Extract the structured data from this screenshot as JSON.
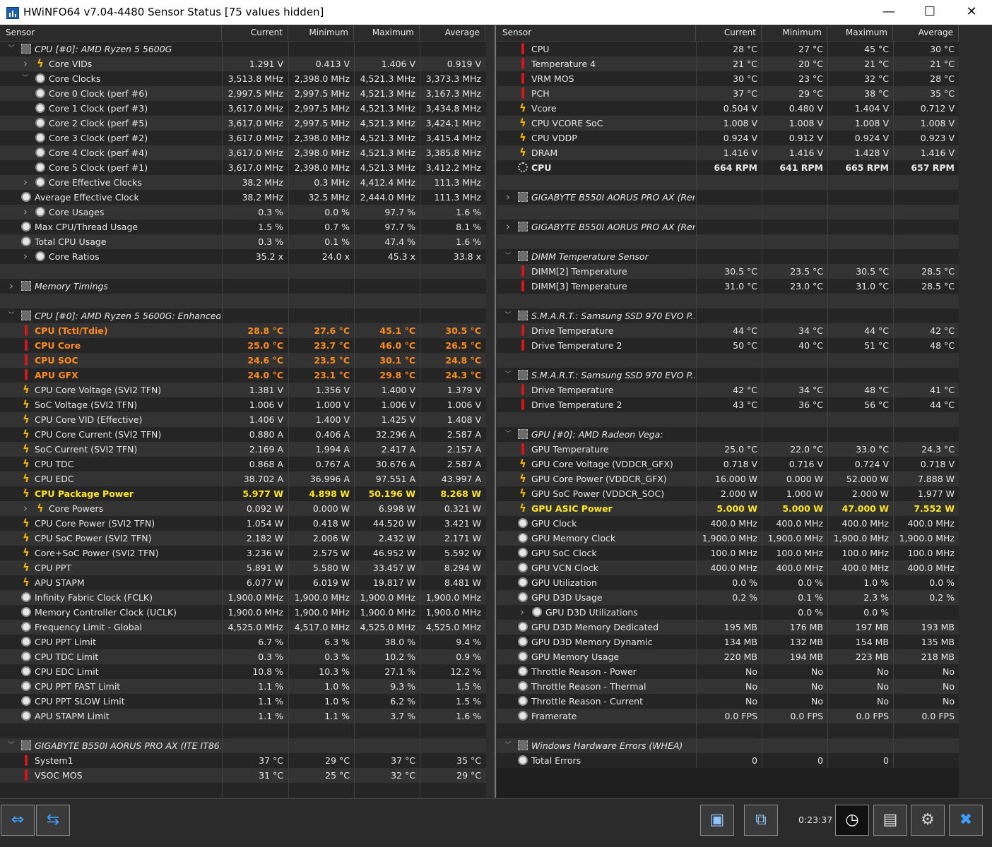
{
  "window": {
    "title": "HWiNFO64 v7.04-4480 Sensor Status [75 values hidden]",
    "minimize": "—",
    "maximize": "☐",
    "close": "✕"
  },
  "columns": {
    "sensor": "Sensor",
    "current": "Current",
    "minimum": "Minimum",
    "maximum": "Maximum",
    "average": "Average"
  },
  "left_rows": [
    {
      "type": "group",
      "expand": "v",
      "icon": "chip",
      "name": "CPU [#0]: AMD Ryzen 5 5600G",
      "vals": [
        "",
        "",
        "",
        ""
      ]
    },
    {
      "expand": ">",
      "icon": "bolt",
      "indent": 1,
      "name": "Core VIDs",
      "vals": [
        "1.291 V",
        "0.413 V",
        "1.406 V",
        "0.919 V"
      ]
    },
    {
      "expand": "v",
      "icon": "clock",
      "indent": 1,
      "name": "Core Clocks",
      "vals": [
        "3,513.8 MHz",
        "2,398.0 MHz",
        "4,521.3 MHz",
        "3,373.3 MHz"
      ]
    },
    {
      "icon": "clock",
      "indent": 1,
      "name": "Core 0 Clock (perf #6)",
      "vals": [
        "2,997.5 MHz",
        "2,997.5 MHz",
        "4,521.3 MHz",
        "3,167.3 MHz"
      ]
    },
    {
      "icon": "clock",
      "indent": 1,
      "name": "Core 1 Clock (perf #3)",
      "vals": [
        "3,617.0 MHz",
        "2,997.5 MHz",
        "4,521.3 MHz",
        "3,434.8 MHz"
      ]
    },
    {
      "icon": "clock",
      "indent": 1,
      "name": "Core 2 Clock (perf #5)",
      "vals": [
        "3,617.0 MHz",
        "2,997.5 MHz",
        "4,521.3 MHz",
        "3,424.1 MHz"
      ]
    },
    {
      "icon": "clock",
      "indent": 1,
      "name": "Core 3 Clock (perf #2)",
      "vals": [
        "3,617.0 MHz",
        "2,398.0 MHz",
        "4,521.3 MHz",
        "3,415.4 MHz"
      ]
    },
    {
      "icon": "clock",
      "indent": 1,
      "name": "Core 4 Clock (perf #4)",
      "vals": [
        "3,617.0 MHz",
        "2,398.0 MHz",
        "4,521.3 MHz",
        "3,385.8 MHz"
      ]
    },
    {
      "icon": "clock",
      "indent": 1,
      "name": "Core 5 Clock (perf #1)",
      "vals": [
        "3,617.0 MHz",
        "2,398.0 MHz",
        "4,521.3 MHz",
        "3,412.2 MHz"
      ]
    },
    {
      "expand": ">",
      "icon": "clock",
      "indent": 1,
      "name": "Core Effective Clocks",
      "vals": [
        "38.2 MHz",
        "0.3 MHz",
        "4,412.4 MHz",
        "111.3 MHz"
      ]
    },
    {
      "icon": "clock",
      "indent": 0,
      "name": "Average Effective Clock",
      "vals": [
        "38.2 MHz",
        "32.5 MHz",
        "2,444.0 MHz",
        "111.3 MHz"
      ]
    },
    {
      "expand": ">",
      "icon": "clock",
      "indent": 1,
      "name": "Core Usages",
      "vals": [
        "0.3 %",
        "0.0 %",
        "97.7 %",
        "1.6 %"
      ]
    },
    {
      "icon": "clock",
      "indent": 0,
      "name": "Max CPU/Thread Usage",
      "vals": [
        "1.5 %",
        "0.7 %",
        "97.7 %",
        "8.1 %"
      ]
    },
    {
      "icon": "clock",
      "indent": 0,
      "name": "Total CPU Usage",
      "vals": [
        "0.3 %",
        "0.1 %",
        "47.4 %",
        "1.6 %"
      ]
    },
    {
      "expand": ">",
      "icon": "clock",
      "indent": 1,
      "name": "Core Ratios",
      "vals": [
        "35.2 x",
        "24.0 x",
        "45.3 x",
        "33.8 x"
      ]
    },
    {
      "type": "blank",
      "name": "",
      "vals": [
        "",
        "",
        "",
        ""
      ]
    },
    {
      "type": "group",
      "expand": ">",
      "icon": "chip",
      "name": "Memory Timings",
      "vals": [
        "",
        "",
        "",
        ""
      ]
    },
    {
      "type": "blank",
      "name": "",
      "vals": [
        "",
        "",
        "",
        ""
      ]
    },
    {
      "type": "group",
      "expand": "v",
      "icon": "chip",
      "name": "CPU [#0]: AMD Ryzen 5 5600G: Enhanced",
      "vals": [
        "",
        "",
        "",
        ""
      ]
    },
    {
      "style": "orange",
      "icon": "thermo",
      "indent": 0,
      "name": "CPU (Tctl/Tdie)",
      "vals": [
        "28.8 °C",
        "27.6 °C",
        "45.1 °C",
        "30.5 °C"
      ]
    },
    {
      "style": "orange",
      "icon": "thermo",
      "indent": 0,
      "name": "CPU Core",
      "vals": [
        "25.0 °C",
        "23.7 °C",
        "46.0 °C",
        "26.5 °C"
      ]
    },
    {
      "style": "orange",
      "icon": "thermo",
      "indent": 0,
      "name": "CPU SOC",
      "vals": [
        "24.6 °C",
        "23.5 °C",
        "30.1 °C",
        "24.8 °C"
      ]
    },
    {
      "style": "orange",
      "icon": "thermo",
      "indent": 0,
      "name": "APU GFX",
      "vals": [
        "24.0 °C",
        "23.1 °C",
        "29.8 °C",
        "24.3 °C"
      ]
    },
    {
      "icon": "bolt",
      "indent": 0,
      "name": "CPU Core Voltage (SVI2 TFN)",
      "vals": [
        "1.381 V",
        "1.356 V",
        "1.400 V",
        "1.379 V"
      ]
    },
    {
      "icon": "bolt",
      "indent": 0,
      "name": "SoC Voltage (SVI2 TFN)",
      "vals": [
        "1.006 V",
        "1.000 V",
        "1.006 V",
        "1.006 V"
      ]
    },
    {
      "icon": "bolt",
      "indent": 0,
      "name": "CPU Core VID (Effective)",
      "vals": [
        "1.406 V",
        "1.400 V",
        "1.425 V",
        "1.408 V"
      ]
    },
    {
      "icon": "bolt",
      "indent": 0,
      "name": "CPU Core Current (SVI2 TFN)",
      "vals": [
        "0.880 A",
        "0.406 A",
        "32.296 A",
        "2.587 A"
      ]
    },
    {
      "icon": "bolt",
      "indent": 0,
      "name": "SoC Current (SVI2 TFN)",
      "vals": [
        "2.169 A",
        "1.994 A",
        "2.417 A",
        "2.157 A"
      ]
    },
    {
      "icon": "bolt",
      "indent": 0,
      "name": "CPU TDC",
      "vals": [
        "0.868 A",
        "0.767 A",
        "30.676 A",
        "2.587 A"
      ]
    },
    {
      "icon": "bolt",
      "indent": 0,
      "name": "CPU EDC",
      "vals": [
        "38.702 A",
        "36.996 A",
        "97.551 A",
        "43.997 A"
      ]
    },
    {
      "style": "yellow",
      "icon": "bolt",
      "indent": 0,
      "name": "CPU Package Power",
      "vals": [
        "5.977 W",
        "4.898 W",
        "50.196 W",
        "8.268 W"
      ]
    },
    {
      "expand": ">",
      "icon": "bolt",
      "indent": 1,
      "name": "Core Powers",
      "vals": [
        "0.092 W",
        "0.000 W",
        "6.998 W",
        "0.321 W"
      ]
    },
    {
      "icon": "bolt",
      "indent": 0,
      "name": "CPU Core Power (SVI2 TFN)",
      "vals": [
        "1.054 W",
        "0.418 W",
        "44.520 W",
        "3.421 W"
      ]
    },
    {
      "icon": "bolt",
      "indent": 0,
      "name": "CPU SoC Power (SVI2 TFN)",
      "vals": [
        "2.182 W",
        "2.006 W",
        "2.432 W",
        "2.171 W"
      ]
    },
    {
      "icon": "bolt",
      "indent": 0,
      "name": "Core+SoC Power (SVI2 TFN)",
      "vals": [
        "3.236 W",
        "2.575 W",
        "46.952 W",
        "5.592 W"
      ]
    },
    {
      "icon": "bolt",
      "indent": 0,
      "name": "CPU PPT",
      "vals": [
        "5.891 W",
        "5.580 W",
        "33.457 W",
        "8.294 W"
      ]
    },
    {
      "icon": "bolt",
      "indent": 0,
      "name": "APU STAPM",
      "vals": [
        "6.077 W",
        "6.019 W",
        "19.817 W",
        "8.481 W"
      ]
    },
    {
      "icon": "clock",
      "indent": 0,
      "name": "Infinity Fabric Clock (FCLK)",
      "vals": [
        "1,900.0 MHz",
        "1,900.0 MHz",
        "1,900.0 MHz",
        "1,900.0 MHz"
      ]
    },
    {
      "icon": "clock",
      "indent": 0,
      "name": "Memory Controller Clock (UCLK)",
      "vals": [
        "1,900.0 MHz",
        "1,900.0 MHz",
        "1,900.0 MHz",
        "1,900.0 MHz"
      ]
    },
    {
      "icon": "clock",
      "indent": 0,
      "name": "Frequency Limit - Global",
      "vals": [
        "4,525.0 MHz",
        "4,517.0 MHz",
        "4,525.0 MHz",
        "4,525.0 MHz"
      ]
    },
    {
      "icon": "clock",
      "indent": 0,
      "name": "CPU PPT Limit",
      "vals": [
        "6.7 %",
        "6.3 %",
        "38.0 %",
        "9.4 %"
      ]
    },
    {
      "icon": "clock",
      "indent": 0,
      "name": "CPU TDC Limit",
      "vals": [
        "0.3 %",
        "0.3 %",
        "10.2 %",
        "0.9 %"
      ]
    },
    {
      "icon": "clock",
      "indent": 0,
      "name": "CPU EDC Limit",
      "vals": [
        "10.8 %",
        "10.3 %",
        "27.1 %",
        "12.2 %"
      ]
    },
    {
      "icon": "clock",
      "indent": 0,
      "name": "CPU PPT FAST Limit",
      "vals": [
        "1.1 %",
        "1.0 %",
        "9.3 %",
        "1.5 %"
      ]
    },
    {
      "icon": "clock",
      "indent": 0,
      "name": "CPU PPT SLOW Limit",
      "vals": [
        "1.1 %",
        "1.0 %",
        "6.2 %",
        "1.5 %"
      ]
    },
    {
      "icon": "clock",
      "indent": 0,
      "name": "APU STAPM Limit",
      "vals": [
        "1.1 %",
        "1.1 %",
        "3.7 %",
        "1.6 %"
      ]
    },
    {
      "type": "blank",
      "name": "",
      "vals": [
        "",
        "",
        "",
        ""
      ]
    },
    {
      "type": "group",
      "expand": "v",
      "icon": "chip",
      "name": "GIGABYTE B550I AORUS PRO AX (ITE IT86...",
      "vals": [
        "",
        "",
        "",
        ""
      ]
    },
    {
      "icon": "thermo",
      "indent": 0,
      "name": "System1",
      "vals": [
        "37 °C",
        "29 °C",
        "37 °C",
        "35 °C"
      ]
    },
    {
      "icon": "thermo",
      "indent": 0,
      "name": "VSOC MOS",
      "vals": [
        "31 °C",
        "25 °C",
        "32 °C",
        "29 °C"
      ]
    },
    {
      "type": "blank",
      "name": "",
      "vals": [
        "",
        "",
        "",
        ""
      ]
    }
  ],
  "right_rows": [
    {
      "icon": "thermo",
      "indent": 0,
      "name": "CPU",
      "vals": [
        "28 °C",
        "27 °C",
        "45 °C",
        "30 °C"
      ]
    },
    {
      "icon": "thermo",
      "indent": 0,
      "name": "Temperature 4",
      "vals": [
        "21 °C",
        "20 °C",
        "21 °C",
        "21 °C"
      ]
    },
    {
      "icon": "thermo",
      "indent": 0,
      "name": "VRM MOS",
      "vals": [
        "30 °C",
        "23 °C",
        "32 °C",
        "28 °C"
      ]
    },
    {
      "icon": "thermo",
      "indent": 0,
      "name": "PCH",
      "vals": [
        "37 °C",
        "29 °C",
        "38 °C",
        "35 °C"
      ]
    },
    {
      "icon": "bolt",
      "indent": 0,
      "name": "Vcore",
      "vals": [
        "0.504 V",
        "0.480 V",
        "1.404 V",
        "0.712 V"
      ]
    },
    {
      "icon": "bolt",
      "indent": 0,
      "name": "CPU VCORE SoC",
      "vals": [
        "1.008 V",
        "1.008 V",
        "1.008 V",
        "1.008 V"
      ]
    },
    {
      "icon": "bolt",
      "indent": 0,
      "name": "CPU VDDP",
      "vals": [
        "0.924 V",
        "0.912 V",
        "0.924 V",
        "0.923 V"
      ]
    },
    {
      "icon": "bolt",
      "indent": 0,
      "name": "DRAM",
      "vals": [
        "1.416 V",
        "1.416 V",
        "1.428 V",
        "1.416 V"
      ]
    },
    {
      "style": "bold",
      "icon": "fan",
      "indent": 0,
      "name": "CPU",
      "vals": [
        "664 RPM",
        "641 RPM",
        "665 RPM",
        "657 RPM"
      ]
    },
    {
      "type": "blank",
      "name": "",
      "vals": [
        "",
        "",
        "",
        ""
      ]
    },
    {
      "type": "group",
      "expand": ">",
      "icon": "chip",
      "name": "GIGABYTE B550I AORUS PRO AX (Ren...",
      "vals": [
        "",
        "",
        "",
        ""
      ]
    },
    {
      "type": "blank",
      "name": "",
      "vals": [
        "",
        "",
        "",
        ""
      ]
    },
    {
      "type": "group",
      "expand": ">",
      "icon": "chip",
      "name": "GIGABYTE B550I AORUS PRO AX (Ren...",
      "vals": [
        "",
        "",
        "",
        ""
      ]
    },
    {
      "type": "blank",
      "name": "",
      "vals": [
        "",
        "",
        "",
        ""
      ]
    },
    {
      "type": "group",
      "expand": "v",
      "icon": "chip",
      "name": "DIMM Temperature Sensor",
      "vals": [
        "",
        "",
        "",
        ""
      ]
    },
    {
      "icon": "thermo",
      "indent": 0,
      "name": "DIMM[2] Temperature",
      "vals": [
        "30.5 °C",
        "23.5 °C",
        "30.5 °C",
        "28.5 °C"
      ]
    },
    {
      "icon": "thermo",
      "indent": 0,
      "name": "DIMM[3] Temperature",
      "vals": [
        "31.0 °C",
        "23.0 °C",
        "31.0 °C",
        "28.5 °C"
      ]
    },
    {
      "type": "blank",
      "name": "",
      "vals": [
        "",
        "",
        "",
        ""
      ]
    },
    {
      "type": "group",
      "expand": "v",
      "icon": "chip",
      "name": "S.M.A.R.T.: Samsung SSD 970 EVO P...",
      "vals": [
        "",
        "",
        "",
        ""
      ]
    },
    {
      "icon": "thermo",
      "indent": 0,
      "name": "Drive Temperature",
      "vals": [
        "44 °C",
        "34 °C",
        "44 °C",
        "42 °C"
      ]
    },
    {
      "icon": "thermo",
      "indent": 0,
      "name": "Drive Temperature 2",
      "vals": [
        "50 °C",
        "40 °C",
        "51 °C",
        "48 °C"
      ]
    },
    {
      "type": "blank",
      "name": "",
      "vals": [
        "",
        "",
        "",
        ""
      ]
    },
    {
      "type": "group",
      "expand": "v",
      "icon": "chip",
      "name": "S.M.A.R.T.: Samsung SSD 970 EVO P...",
      "vals": [
        "",
        "",
        "",
        ""
      ]
    },
    {
      "icon": "thermo",
      "indent": 0,
      "name": "Drive Temperature",
      "vals": [
        "42 °C",
        "34 °C",
        "48 °C",
        "41 °C"
      ]
    },
    {
      "icon": "thermo",
      "indent": 0,
      "name": "Drive Temperature 2",
      "vals": [
        "43 °C",
        "36 °C",
        "56 °C",
        "44 °C"
      ]
    },
    {
      "type": "blank",
      "name": "",
      "vals": [
        "",
        "",
        "",
        ""
      ]
    },
    {
      "type": "group",
      "expand": "v",
      "icon": "chip",
      "name": "GPU [#0]: AMD Radeon Vega:",
      "vals": [
        "",
        "",
        "",
        ""
      ]
    },
    {
      "icon": "thermo",
      "indent": 0,
      "name": "GPU Temperature",
      "vals": [
        "25.0 °C",
        "22.0 °C",
        "33.0 °C",
        "24.3 °C"
      ]
    },
    {
      "icon": "bolt",
      "indent": 0,
      "name": "GPU Core Voltage (VDDCR_GFX)",
      "vals": [
        "0.718 V",
        "0.716 V",
        "0.724 V",
        "0.718 V"
      ]
    },
    {
      "icon": "bolt",
      "indent": 0,
      "name": "GPU Core Power (VDDCR_GFX)",
      "vals": [
        "16.000 W",
        "0.000 W",
        "52.000 W",
        "7.888 W"
      ]
    },
    {
      "icon": "bolt",
      "indent": 0,
      "name": "GPU SoC Power (VDDCR_SOC)",
      "vals": [
        "2.000 W",
        "1.000 W",
        "2.000 W",
        "1.977 W"
      ]
    },
    {
      "style": "yellow",
      "icon": "bolt",
      "indent": 0,
      "name": "GPU ASIC Power",
      "vals": [
        "5.000 W",
        "5.000 W",
        "47.000 W",
        "7.552 W"
      ]
    },
    {
      "icon": "clock",
      "indent": 0,
      "name": "GPU Clock",
      "vals": [
        "400.0 MHz",
        "400.0 MHz",
        "400.0 MHz",
        "400.0 MHz"
      ]
    },
    {
      "icon": "clock",
      "indent": 0,
      "name": "GPU Memory Clock",
      "vals": [
        "1,900.0 MHz",
        "1,900.0 MHz",
        "1,900.0 MHz",
        "1,900.0 MHz"
      ]
    },
    {
      "icon": "clock",
      "indent": 0,
      "name": "GPU SoC Clock",
      "vals": [
        "100.0 MHz",
        "100.0 MHz",
        "100.0 MHz",
        "100.0 MHz"
      ]
    },
    {
      "icon": "clock",
      "indent": 0,
      "name": "GPU VCN Clock",
      "vals": [
        "400.0 MHz",
        "400.0 MHz",
        "400.0 MHz",
        "400.0 MHz"
      ]
    },
    {
      "icon": "clock",
      "indent": 0,
      "name": "GPU Utilization",
      "vals": [
        "0.0 %",
        "0.0 %",
        "1.0 %",
        "0.0 %"
      ]
    },
    {
      "icon": "clock",
      "indent": 0,
      "name": "GPU D3D Usage",
      "vals": [
        "0.2 %",
        "0.1 %",
        "2.3 %",
        "0.2 %"
      ]
    },
    {
      "expand": ">",
      "icon": "clock",
      "indent": 1,
      "name": "GPU D3D Utilizations",
      "vals": [
        "",
        "0.0 %",
        "0.0 %",
        ""
      ]
    },
    {
      "icon": "clock",
      "indent": 0,
      "name": "GPU D3D Memory Dedicated",
      "vals": [
        "195 MB",
        "176 MB",
        "197 MB",
        "193 MB"
      ]
    },
    {
      "icon": "clock",
      "indent": 0,
      "name": "GPU D3D Memory Dynamic",
      "vals": [
        "134 MB",
        "132 MB",
        "154 MB",
        "135 MB"
      ]
    },
    {
      "icon": "clock",
      "indent": 0,
      "name": "GPU Memory Usage",
      "vals": [
        "220 MB",
        "194 MB",
        "223 MB",
        "218 MB"
      ]
    },
    {
      "icon": "clock",
      "indent": 0,
      "name": "Throttle Reason - Power",
      "vals": [
        "No",
        "No",
        "No",
        "No"
      ]
    },
    {
      "icon": "clock",
      "indent": 0,
      "name": "Throttle Reason - Thermal",
      "vals": [
        "No",
        "No",
        "No",
        "No"
      ]
    },
    {
      "icon": "clock",
      "indent": 0,
      "name": "Throttle Reason - Current",
      "vals": [
        "No",
        "No",
        "No",
        "No"
      ]
    },
    {
      "icon": "clock",
      "indent": 0,
      "name": "Framerate",
      "vals": [
        "0.0 FPS",
        "0.0 FPS",
        "0.0 FPS",
        "0.0 FPS"
      ]
    },
    {
      "type": "blank",
      "name": "",
      "vals": [
        "",
        "",
        "",
        ""
      ]
    },
    {
      "type": "group",
      "expand": "v",
      "icon": "chip",
      "name": "Windows Hardware Errors (WHEA)",
      "vals": [
        "",
        "",
        "",
        ""
      ]
    },
    {
      "icon": "clock",
      "indent": 0,
      "name": "Total Errors",
      "vals": [
        "0",
        "0",
        "0",
        ""
      ]
    }
  ],
  "bottom": {
    "timer": "0:23:37",
    "buttons": [
      {
        "name": "nav-back-forward-button",
        "glyph": "⇔"
      },
      {
        "name": "nav-collapse-button",
        "glyph": "⇆"
      },
      {
        "name": "monitor-button",
        "glyph": "▣"
      },
      {
        "name": "network-button",
        "glyph": "⧉"
      },
      {
        "name": "clock-button",
        "glyph": "◷"
      },
      {
        "name": "add-report-button",
        "glyph": "▤"
      },
      {
        "name": "settings-button",
        "glyph": "⚙"
      },
      {
        "name": "close-button",
        "glyph": "✖"
      }
    ]
  }
}
